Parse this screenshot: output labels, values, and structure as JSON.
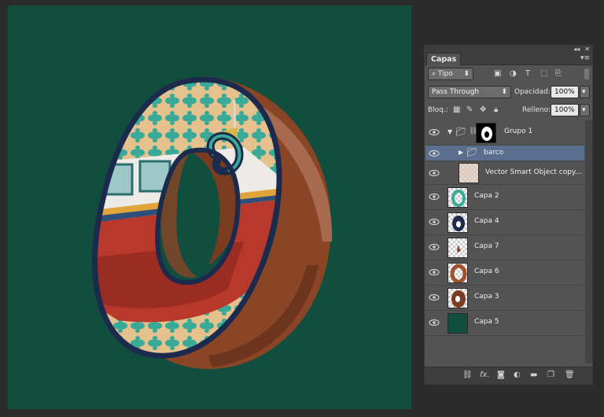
{
  "panel": {
    "collapse_icon": "double-chevron",
    "close_icon": "close",
    "tab_label": "Capas",
    "menu_icon": "panel-menu",
    "filter": {
      "kind_label": "Tipo"
    },
    "blend_mode": "Pass Through",
    "opacity_label": "Opacidad:",
    "opacity_value": "100%",
    "lock_label": "Bloq.:",
    "fill_label": "Relleno:",
    "fill_value": "100%",
    "layers": [
      {
        "name": "Grupo 1",
        "kind": "group",
        "expanded": true
      },
      {
        "name": "barco",
        "kind": "group",
        "expanded": false,
        "selected": true
      },
      {
        "name": "Vector Smart Object copy..."
      },
      {
        "name": "Capa 2"
      },
      {
        "name": "Capa 4"
      },
      {
        "name": "Capa 7"
      },
      {
        "name": "Capa 6"
      },
      {
        "name": "Capa 3"
      },
      {
        "name": "Capa 5"
      }
    ]
  },
  "colors": {
    "canvas_bg": "#124e3e",
    "selected_row": "#5a6e8e",
    "letter_outline": "#1c2a4d",
    "pattern_teal": "#3aaa98",
    "pattern_tan": "#e4c18d",
    "extrusion_brown": "#8a4526"
  }
}
